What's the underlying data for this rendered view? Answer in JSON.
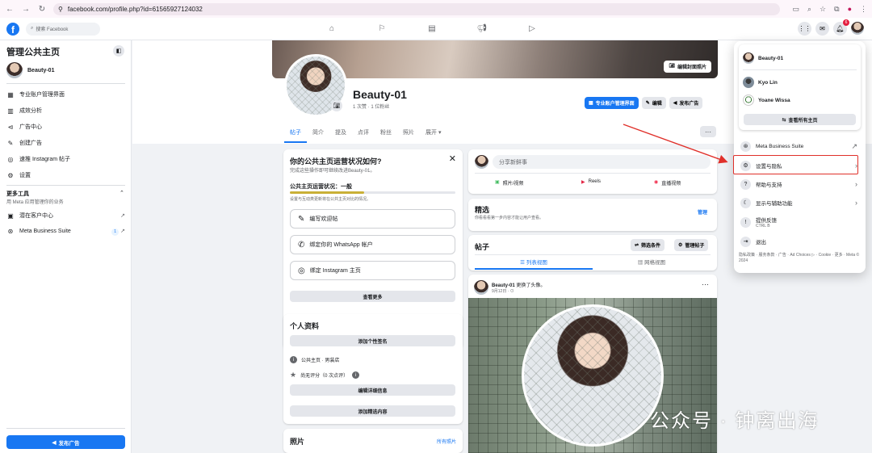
{
  "browser": {
    "url": "facebook.com/profile.php?id=61565927124032"
  },
  "nav": {
    "search_placeholder": "搜索 Facebook",
    "notif_count": "6"
  },
  "sidebar": {
    "title": "管理公共主页",
    "page_name": "Beauty-01",
    "items": [
      {
        "label": "专业账户管理界面",
        "icon": "dashboard-icon"
      },
      {
        "label": "成效分析",
        "icon": "insights-icon"
      },
      {
        "label": "广告中心",
        "icon": "megaphone-icon"
      },
      {
        "label": "创建广告",
        "icon": "edit-icon"
      },
      {
        "label": "速推 Instagram 帖子",
        "icon": "instagram-icon"
      },
      {
        "label": "设置",
        "icon": "gear-icon"
      }
    ],
    "more_tools": "更多工具",
    "more_tools_sub": "用 Meta 应用管理你的业务",
    "tool_items": [
      {
        "label": "潜在客户中心",
        "icon": "leads-icon"
      },
      {
        "label": "Meta Business Suite",
        "icon": "meta-icon",
        "badge": "1"
      }
    ],
    "ad_button": "发布广告"
  },
  "profile": {
    "cover_button": "编辑封面照片",
    "name": "Beauty-01",
    "stats": "1 次赞 · 1 位粉丝",
    "btn_dashboard": "专业账户管理界面",
    "btn_edit": "编辑",
    "btn_ad": "发布广告",
    "tabs": [
      "帖子",
      "简介",
      "提及",
      "点评",
      "粉丝",
      "照片",
      "展开 ▾"
    ]
  },
  "status_card": {
    "title": "你的公共主页运营状况如何?",
    "subtitle": "完成这些操作即可继续改进Beauty-01。",
    "status_label": "公共主页运营状况：一般",
    "status_note": "设置与互动类更新将在公共主页对比的情况。",
    "progress": 0.45,
    "actions": [
      "编写欢迎帖",
      "绑定你的 WhatsApp 帐户",
      "绑定 Instagram 主页"
    ],
    "see_more": "查看更多"
  },
  "about_card": {
    "title": "个人资料",
    "add_bio": "添加个性签名",
    "category": "公共主页 · 男装店",
    "rating": "尚无评分（0 次点评）",
    "edit_details": "编辑详细信息",
    "add_featured": "添加精选内容"
  },
  "photos_card": {
    "title": "照片",
    "link": "所有照片"
  },
  "composer": {
    "placeholder": "分享新鲜事",
    "photo": "照片/视频",
    "reels": "Reels",
    "live": "直播视频"
  },
  "featured": {
    "title": "精选",
    "sub": "你看看看第一步内容才能让用户查看。",
    "manage": "管理"
  },
  "posts": {
    "title": "帖子",
    "filter": "筛选条件",
    "manage": "管理帖子",
    "list_view": "列表视图",
    "grid_view": "网格视图"
  },
  "post": {
    "author": "Beauty-01",
    "action": "更换了头像。",
    "time": "9月12日 · ⊙"
  },
  "watermark": "公众号 · 钟离出海",
  "menu": {
    "accounts": [
      "Beauty-01",
      "Kyo Lin",
      "Yoane Wissa"
    ],
    "see_all": "查看所有主页",
    "items": [
      {
        "label": "Meta Business Suite",
        "icon": "meta-icon"
      },
      {
        "label": "设置与隐私",
        "icon": "gear-icon"
      },
      {
        "label": "帮助与支持",
        "icon": "help-icon"
      },
      {
        "label": "显示与辅助功能",
        "icon": "moon-icon"
      },
      {
        "label": "提供反馈",
        "sub": "CTRL B",
        "icon": "feedback-icon"
      },
      {
        "label": "退出",
        "icon": "logout-icon"
      }
    ],
    "footer": "隐私政策 · 服务条款 · 广告 · Ad Choices ▷ · Cookie · 更多 · Meta © 2024"
  },
  "colors": {
    "accent": "#1877f2",
    "highlight": "#e0302a"
  }
}
